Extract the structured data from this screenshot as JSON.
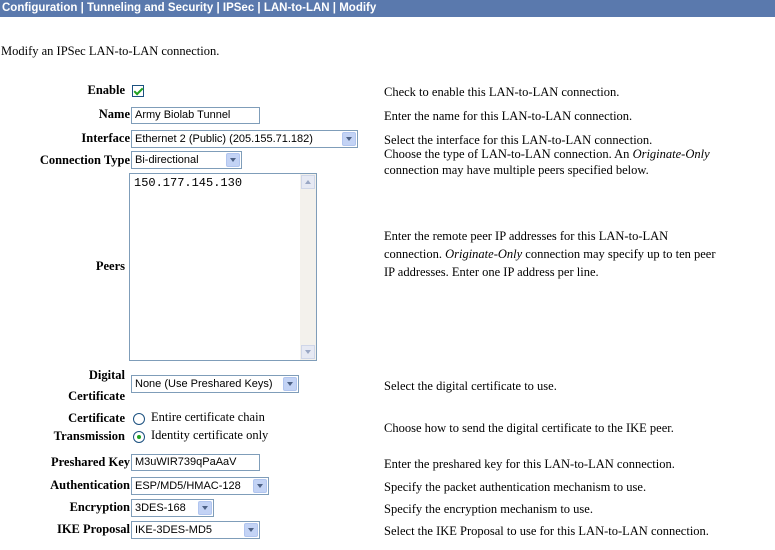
{
  "breadcrumb": "Configuration | Tunneling and Security | IPSec | LAN-to-LAN | Modify",
  "intro": "Modify an IPSec LAN-to-LAN connection.",
  "enable": {
    "label": "Enable",
    "checked": true,
    "help": "Check to enable this LAN-to-LAN connection."
  },
  "name": {
    "label": "Name",
    "value": "Army Biolab Tunnel",
    "help": "Enter the name for this LAN-to-LAN connection."
  },
  "interface": {
    "label": "Interface",
    "value": "Ethernet 2 (Public) (205.155.71.182)",
    "help": "Select the interface for this LAN-to-LAN connection."
  },
  "connection_type": {
    "label": "Connection Type",
    "value": "Bi-directional",
    "help1_a": "Choose the type of LAN-to-LAN connection. An ",
    "help1_i": "Originate-Only",
    "help2": "connection may have multiple peers specified below."
  },
  "peers": {
    "label": "Peers",
    "value": "150.177.145.130",
    "help1": "Enter the remote peer IP addresses for this LAN-to-LAN",
    "help2_a": "connection. ",
    "help2_i": "Originate-Only",
    "help2_b": " connection may specify up to ten peer",
    "help3": "IP addresses. Enter one IP address per line."
  },
  "digital_certificate": {
    "label1": "Digital",
    "label2": "Certificate",
    "value": "None (Use Preshared Keys)",
    "help": "Select the digital certificate to use."
  },
  "certificate_transmission": {
    "label1": "Certificate",
    "label2": "Transmission",
    "option1": "Entire certificate chain",
    "option2": "Identity certificate only",
    "selected": "Identity certificate only",
    "help": "Choose how to send the digital certificate to the IKE peer."
  },
  "preshared_key": {
    "label": "Preshared Key",
    "value": "M3uWIR739qPaAaV",
    "help": "Enter the preshared key for this LAN-to-LAN connection."
  },
  "authentication": {
    "label": "Authentication",
    "value": "ESP/MD5/HMAC-128",
    "help": "Specify the packet authentication mechanism to use."
  },
  "encryption": {
    "label": "Encryption",
    "value": "3DES-168",
    "help": "Specify the encryption mechanism to use."
  },
  "ike_proposal": {
    "label": "IKE Proposal",
    "value": "IKE-3DES-MD5",
    "help": "Select the IKE Proposal to use for this LAN-to-LAN connection."
  },
  "colors": {
    "title_bar": "#5a79ad",
    "check": "#21a121"
  }
}
